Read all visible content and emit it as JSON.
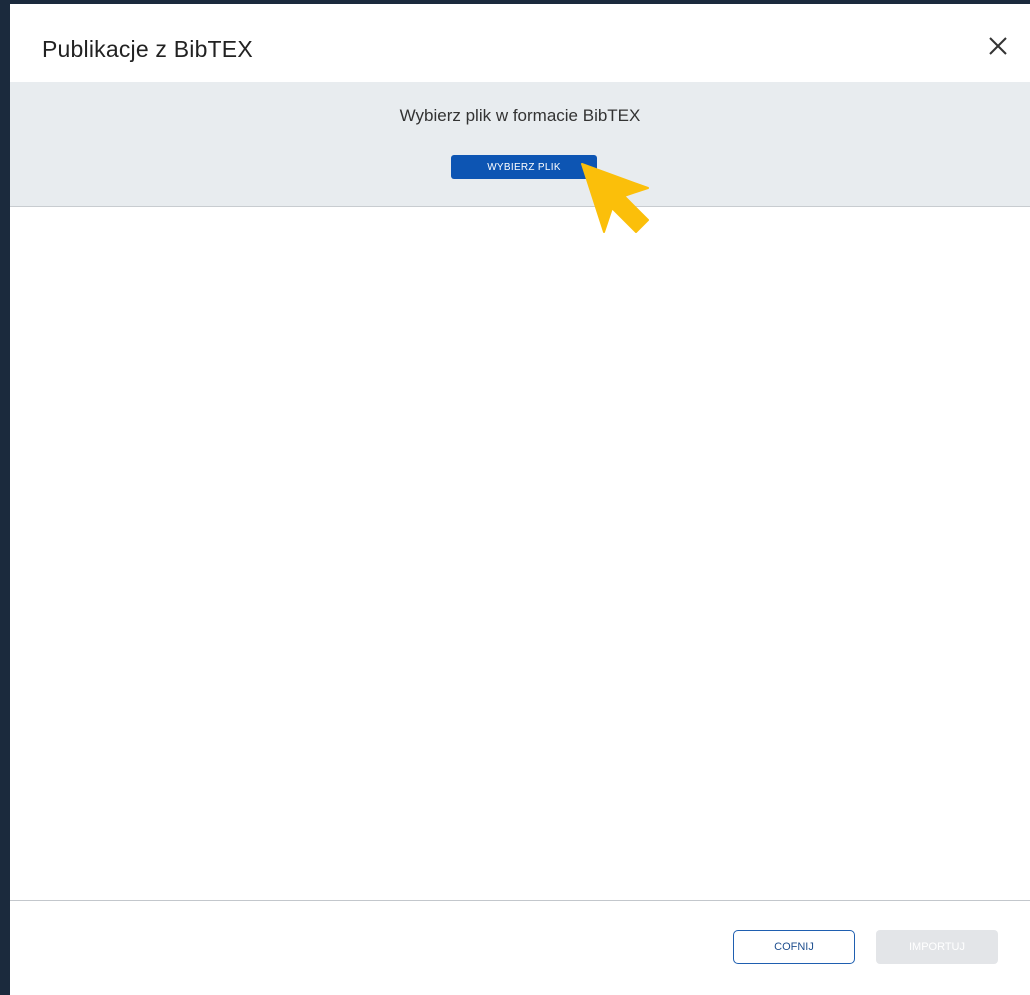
{
  "dialog": {
    "title": "Publikacje z BibTEX",
    "close_icon": "close-icon"
  },
  "file_picker": {
    "label": "Wybierz plik w formacie BibTEX",
    "button_label": "WYBIERZ PLIK",
    "button_color": "#0d55b3",
    "pointer_icon": "pointer-arrow-icon",
    "pointer_color": "#fbbf0a"
  },
  "footer": {
    "back_label": "COFNIJ",
    "import_label": "IMPORTUJ",
    "import_disabled": true
  }
}
